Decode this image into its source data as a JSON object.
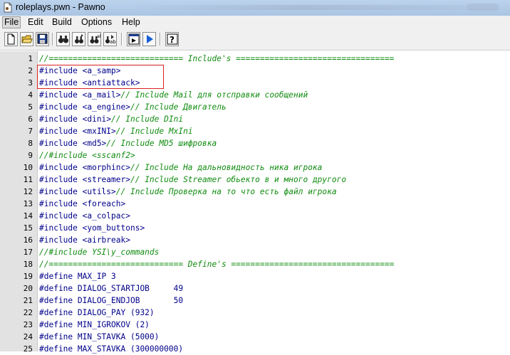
{
  "window": {
    "title": "roleplays.pwn - Pawno"
  },
  "menu": [
    "File",
    "Edit",
    "Build",
    "Options",
    "Help"
  ],
  "toolbar": {
    "buttons": [
      "new-file-icon",
      "open-folder-icon",
      "save-icon",
      "find-icon",
      "find-next-icon",
      "replace-icon",
      "goto-line-icon",
      "compile-icon",
      "run-icon",
      "help-icon"
    ]
  },
  "editor": {
    "lines": [
      {
        "n": "1",
        "code": "",
        "comment": "//============================ Include's ================================="
      },
      {
        "n": "2",
        "code": "#include <a_samp>",
        "comment": ""
      },
      {
        "n": "3",
        "code": "#include <antiattack>",
        "comment": ""
      },
      {
        "n": "4",
        "code": "#include <a_mail>",
        "comment": "// Include Mail для отсправки сообщений"
      },
      {
        "n": "5",
        "code": "#include <a_engine>",
        "comment": "// Include Двигатель"
      },
      {
        "n": "6",
        "code": "#include <dini>",
        "comment": "// Include DIni"
      },
      {
        "n": "7",
        "code": "#include <mxINI>",
        "comment": "// Include MxIni"
      },
      {
        "n": "8",
        "code": "#include <md5>",
        "comment": "// Include MD5 шифровка"
      },
      {
        "n": "9",
        "code": "",
        "comment": "//#include <sscanf2>"
      },
      {
        "n": "10",
        "code": "#include <morphinc>",
        "comment": "// Include На дальновидность ника игрока"
      },
      {
        "n": "11",
        "code": "#include <streamer>",
        "comment": "// Include Streamer обьекто в и много другого"
      },
      {
        "n": "12",
        "code": "#include <utils>",
        "comment": "// Include Проверка на то что есть файл игрока"
      },
      {
        "n": "13",
        "code": "#include <foreach>",
        "comment": ""
      },
      {
        "n": "14",
        "code": "#include <a_colpac>",
        "comment": ""
      },
      {
        "n": "15",
        "code": "#include <yom_buttons>",
        "comment": ""
      },
      {
        "n": "16",
        "code": "#include <airbreak>",
        "comment": ""
      },
      {
        "n": "17",
        "code": "",
        "comment": "//#include YSI\\y_commands"
      },
      {
        "n": "18",
        "code": "",
        "comment": "//============================ Define's =================================="
      },
      {
        "n": "19",
        "code": "#define MAX_IP 3",
        "comment": ""
      },
      {
        "n": "20",
        "code": "#define DIALOG_STARTJOB     49",
        "comment": ""
      },
      {
        "n": "21",
        "code": "#define DIALOG_ENDJOB       50",
        "comment": ""
      },
      {
        "n": "22",
        "code": "#define DIALOG_PAY (932)",
        "comment": ""
      },
      {
        "n": "23",
        "code": "#define MIN_IGROKOV (2)",
        "comment": ""
      },
      {
        "n": "24",
        "code": "#define MIN_STAVKA (5000)",
        "comment": ""
      },
      {
        "n": "25",
        "code": "#define MAX_STAVKA (300000000)",
        "comment": ""
      }
    ]
  },
  "colors": {
    "code": "#00008b",
    "comment": "#118c11",
    "highlight_box": "#d92020",
    "gutter": "#e2e2e2"
  }
}
